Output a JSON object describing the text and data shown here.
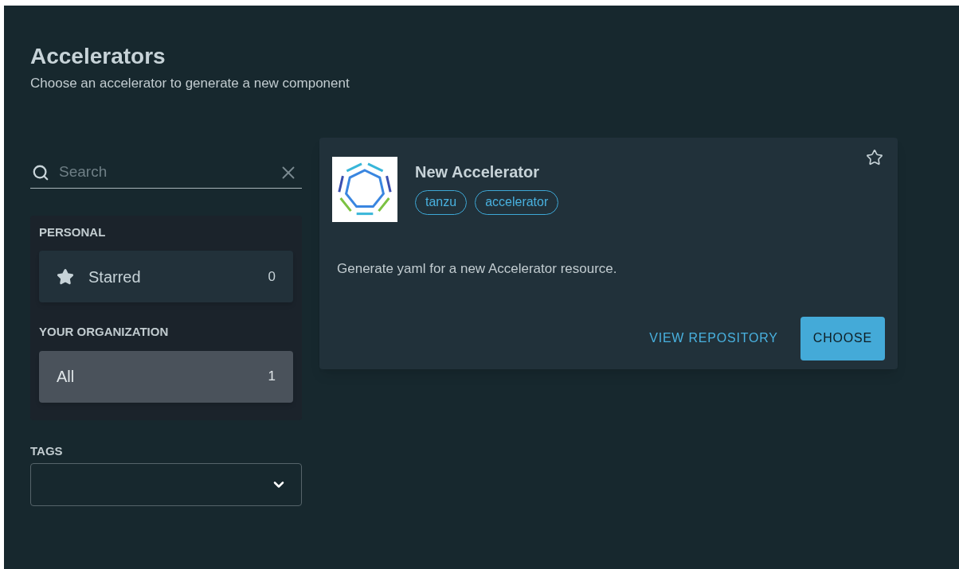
{
  "header": {
    "title": "Accelerators",
    "subtitle": "Choose an accelerator to generate a new component"
  },
  "search": {
    "placeholder": "Search"
  },
  "filters": [
    {
      "heading": "PERSONAL",
      "items": [
        {
          "kind": "starred",
          "label": "Starred",
          "count": "0",
          "selected": false
        }
      ]
    },
    {
      "heading": "YOUR ORGANIZATION",
      "items": [
        {
          "kind": "plain",
          "label": "All",
          "count": "1",
          "selected": true
        }
      ]
    }
  ],
  "tags": {
    "label": "TAGS"
  },
  "cards": [
    {
      "title": "New Accelerator",
      "starred": false,
      "tags": [
        "tanzu",
        "accelerator"
      ],
      "description": "Generate yaml for a new Accelerator resource.",
      "actions": [
        {
          "kind": "link",
          "label": "VIEW REPOSITORY"
        },
        {
          "kind": "primary",
          "label": "CHOOSE"
        }
      ]
    }
  ]
}
